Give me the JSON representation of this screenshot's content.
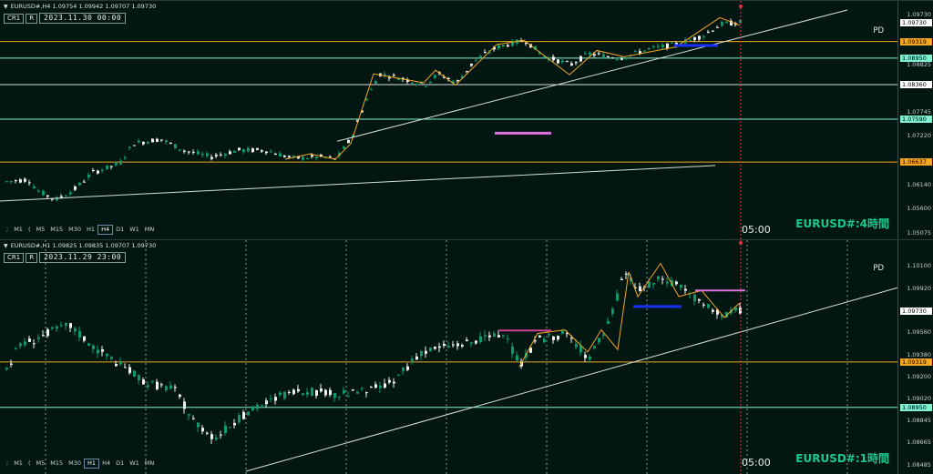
{
  "colors": {
    "background": "#031712",
    "up_candle": "#0f9a6a",
    "down_candle": "#f2f2f2",
    "gold_line": "#f5a623",
    "cyan_line": "#7ff0d0",
    "white_line": "#d8dedc",
    "zigzag": "#f5a623",
    "blue_bar": "#1530ff",
    "pink_bar": "#e070e0",
    "red_time": "#e03040"
  },
  "top_panel": {
    "header": "EURUSD#,H4  1.09754 1.09942 1.09707 1.09730",
    "toolbar": {
      "cr1": "CR1",
      "r": "R",
      "datetime": "2023.11.30 00:00"
    },
    "pd_label": "PD",
    "watermark": "EURUSD#:4時間",
    "time_label": "05:00",
    "timeframes": [
      ";",
      "M1",
      "(",
      "M5",
      "M15",
      "M30",
      "H1",
      "H4",
      "D1",
      "W1",
      "MN"
    ],
    "selected_timeframe": "H4",
    "axis_prices": [
      "1.09730",
      "1.09319",
      "1.08950",
      "1.08825",
      "1.08360",
      "1.07745",
      "1.07590",
      "1.07220",
      "1.06637",
      "1.06140",
      "1.05600",
      "1.05075"
    ],
    "price_values": [
      1.1,
      1.0973,
      1.09319,
      1.0895,
      1.08825,
      1.0836,
      1.07745,
      1.0759,
      1.0722,
      1.06637,
      1.0614,
      1.056,
      1.05075
    ],
    "highlight_labels": [
      {
        "text": "1.09730",
        "kind": "white",
        "price": 1.0973
      },
      {
        "text": "1.09319",
        "kind": "gold",
        "price": 1.09319
      },
      {
        "text": "1.08950",
        "kind": "cyan",
        "price": 1.0895
      },
      {
        "text": "1.08360",
        "kind": "white",
        "price": 1.0836
      },
      {
        "text": "1.07590",
        "kind": "cyan",
        "price": 1.0759
      },
      {
        "text": "1.06637",
        "kind": "gold",
        "price": 1.06637
      }
    ],
    "axis_ticks": [
      {
        "text": "1.09730",
        "price": 1.0992
      },
      {
        "text": "1.08825",
        "price": 1.088
      },
      {
        "text": "1.07745",
        "price": 1.0775
      },
      {
        "text": "1.07220",
        "price": 1.0722
      },
      {
        "text": "1.06140",
        "price": 1.0614
      },
      {
        "text": "1.05600",
        "price": 1.056
      },
      {
        "text": "1.05075",
        "price": 1.0507
      }
    ]
  },
  "bottom_panel": {
    "header": "EURUSD#,H1  1.09825 1.09835 1.09707 1.09730",
    "toolbar": {
      "cr1": "CR1",
      "r": "R",
      "datetime": "2023.11.29 23:00"
    },
    "pd_label": "PD",
    "watermark": "EURUSD#:1時間",
    "time_label": "05:00",
    "timeframes": [
      ";",
      "M1",
      "(",
      "M5",
      "M15",
      "M30",
      "H1",
      "H4",
      "D1",
      "W1",
      "MN"
    ],
    "selected_timeframe": "H1",
    "highlight_labels": [
      {
        "text": "1.09730",
        "kind": "white",
        "price": 1.0973
      },
      {
        "text": "1.09319",
        "kind": "gold",
        "price": 1.09319
      },
      {
        "text": "1.08950",
        "kind": "cyan",
        "price": 1.0895
      }
    ],
    "axis_ticks": [
      {
        "text": "1.10100",
        "price": 1.101
      },
      {
        "text": "1.09920",
        "price": 1.0992
      },
      {
        "text": "1.09560",
        "price": 1.0956
      },
      {
        "text": "1.09380",
        "price": 1.0938
      },
      {
        "text": "1.09200",
        "price": 1.092
      },
      {
        "text": "1.09020",
        "price": 1.0902
      },
      {
        "text": "1.08845",
        "price": 1.08845
      },
      {
        "text": "1.08665",
        "price": 1.08665
      },
      {
        "text": "1.08485",
        "price": 1.08485
      }
    ]
  }
}
